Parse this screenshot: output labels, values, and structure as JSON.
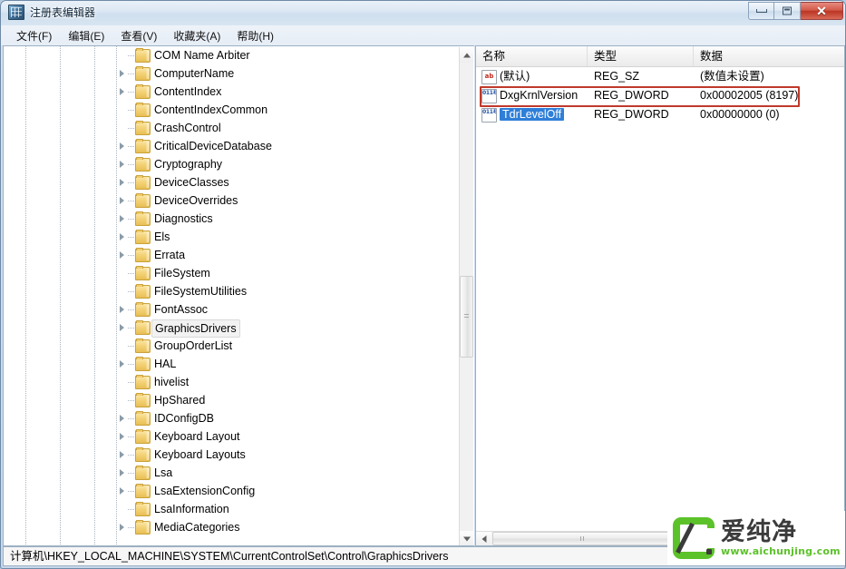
{
  "window": {
    "title": "注册表编辑器",
    "icon": "registry-editor-icon",
    "buttons": {
      "minimize": "minimize-icon",
      "maximize": "maximize-icon",
      "close": "✕"
    }
  },
  "menubar": {
    "items": [
      {
        "label": "文件(F)"
      },
      {
        "label": "编辑(E)"
      },
      {
        "label": "查看(V)"
      },
      {
        "label": "收藏夹(A)"
      },
      {
        "label": "帮助(H)"
      }
    ]
  },
  "tree": {
    "nodes": [
      {
        "label": "COM Name Arbiter",
        "expandable": false,
        "selected": false
      },
      {
        "label": "ComputerName",
        "expandable": true,
        "selected": false
      },
      {
        "label": "ContentIndex",
        "expandable": true,
        "selected": false
      },
      {
        "label": "ContentIndexCommon",
        "expandable": false,
        "selected": false
      },
      {
        "label": "CrashControl",
        "expandable": false,
        "selected": false
      },
      {
        "label": "CriticalDeviceDatabase",
        "expandable": true,
        "selected": false
      },
      {
        "label": "Cryptography",
        "expandable": true,
        "selected": false
      },
      {
        "label": "DeviceClasses",
        "expandable": true,
        "selected": false
      },
      {
        "label": "DeviceOverrides",
        "expandable": true,
        "selected": false
      },
      {
        "label": "Diagnostics",
        "expandable": true,
        "selected": false
      },
      {
        "label": "Els",
        "expandable": true,
        "selected": false
      },
      {
        "label": "Errata",
        "expandable": true,
        "selected": false
      },
      {
        "label": "FileSystem",
        "expandable": false,
        "selected": false
      },
      {
        "label": "FileSystemUtilities",
        "expandable": false,
        "selected": false
      },
      {
        "label": "FontAssoc",
        "expandable": true,
        "selected": false
      },
      {
        "label": "GraphicsDrivers",
        "expandable": true,
        "selected": true
      },
      {
        "label": "GroupOrderList",
        "expandable": false,
        "selected": false
      },
      {
        "label": "HAL",
        "expandable": true,
        "selected": false
      },
      {
        "label": "hivelist",
        "expandable": false,
        "selected": false
      },
      {
        "label": "HpShared",
        "expandable": false,
        "selected": false
      },
      {
        "label": "IDConfigDB",
        "expandable": true,
        "selected": false
      },
      {
        "label": "Keyboard Layout",
        "expandable": true,
        "selected": false
      },
      {
        "label": "Keyboard Layouts",
        "expandable": true,
        "selected": false
      },
      {
        "label": "Lsa",
        "expandable": true,
        "selected": false
      },
      {
        "label": "LsaExtensionConfig",
        "expandable": true,
        "selected": false
      },
      {
        "label": "LsaInformation",
        "expandable": false,
        "selected": false
      },
      {
        "label": "MediaCategories",
        "expandable": true,
        "selected": false
      }
    ]
  },
  "list": {
    "columns": [
      {
        "label": "名称"
      },
      {
        "label": "类型"
      },
      {
        "label": "数据"
      }
    ],
    "rows": [
      {
        "name": "(默认)",
        "type": "REG_SZ",
        "data": "(数值未设置)",
        "icon": "string-value-icon",
        "selected": false,
        "highlighted": false
      },
      {
        "name": "DxgKrnlVersion",
        "type": "REG_DWORD",
        "data": "0x00002005 (8197)",
        "icon": "dword-value-icon",
        "selected": false,
        "highlighted": false
      },
      {
        "name": "TdrLevelOff",
        "type": "REG_DWORD",
        "data": "0x00000000 (0)",
        "icon": "dword-value-icon",
        "selected": true,
        "highlighted": true
      }
    ]
  },
  "statusbar": {
    "path": "计算机\\HKEY_LOCAL_MACHINE\\SYSTEM\\CurrentControlSet\\Control\\GraphicsDrivers"
  },
  "watermark": {
    "brand": "爱纯净",
    "url": "www.aichunjing.com"
  },
  "colors": {
    "highlight_red": "#c0392b",
    "selection_blue": "#2f7fd8",
    "brand_green": "#5cc22a",
    "close_button_red": "#bb3524"
  }
}
